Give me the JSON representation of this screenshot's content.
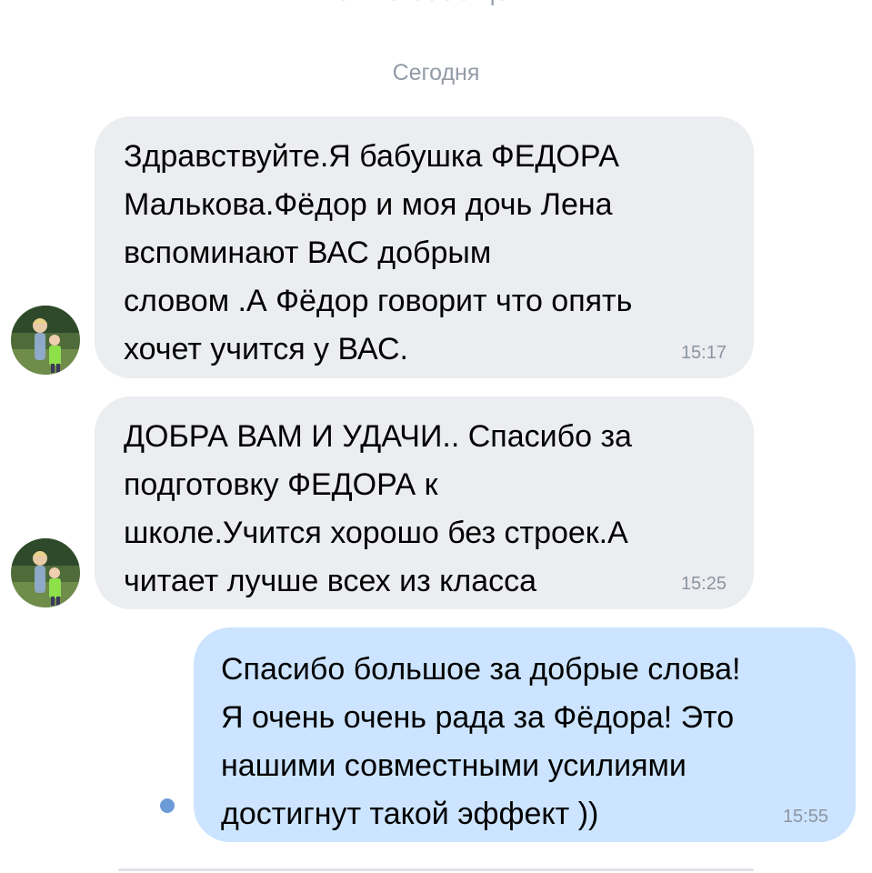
{
  "chat": {
    "new_messages_label": "Новые сообщения",
    "date_separator": "Сегодня",
    "messages": [
      {
        "direction": "incoming",
        "text": "Здравствуйте.Я бабушка ФЕДОРА\nМалькова.Фёдор и моя дочь Лена\nвспоминают ВАС добрым\nсловом .А Фёдор говорит что опять\nхочет учится у ВАС.",
        "time": "15:17"
      },
      {
        "direction": "incoming",
        "text": "ДОБРА ВАМ И УДАЧИ.. Спасибо за\nподготовку ФЕДОРА к\nшколе.Учится хорошо  без строек.А\nчитает лучше всех из класса",
        "time": "15:25"
      },
      {
        "direction": "outgoing",
        "text": "Спасибо большое за добрые слова!\nЯ очень очень рада за Фёдора! Это\nнашими совместными усилиями\nдостигнут такой эффект ))",
        "time": "15:55"
      }
    ]
  },
  "colors": {
    "incoming_bubble": "#ebedf0",
    "outgoing_bubble": "#cce4ff",
    "unread_dot": "#6c9bd8",
    "meta_text": "#939ba6"
  },
  "icons": {
    "avatar": "avatar-photo-grandmother-and-boy",
    "unread": "unread-dot-icon"
  }
}
